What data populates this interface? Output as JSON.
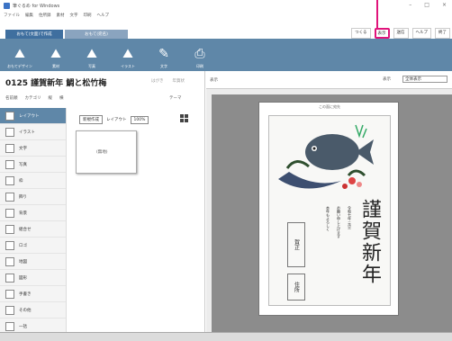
{
  "colors": {
    "accent": "#5f87a8",
    "highlight": "#e0147b",
    "canvas_bg": "#8c8c8c",
    "tab_active": "#3f6f9f",
    "tab_inactive": "#8aa4bf"
  },
  "window": {
    "title": "筆ぐるめ for Windows",
    "controls": [
      "–",
      "□",
      "×"
    ]
  },
  "menubar": [
    "ファイル",
    "編集",
    "住所録",
    "素材",
    "文字",
    "印刷",
    "ヘルプ"
  ],
  "ribbon": {
    "tabs": [
      "おもて(文面)で作成",
      "おもて(宛名)"
    ],
    "right_buttons": [
      {
        "label": "つくる",
        "highlighted": false
      },
      {
        "label": "表示",
        "highlighted": true
      },
      {
        "label": "送信",
        "highlighted": false
      },
      {
        "label": "ヘルプ",
        "highlighted": false
      },
      {
        "label": "終了",
        "highlighted": false
      }
    ]
  },
  "toolbar": [
    {
      "icon": "scenery-icon",
      "label": "おもてデザイン"
    },
    {
      "icon": "scenery-icon",
      "label": "素材"
    },
    {
      "icon": "scenery-icon",
      "label": "写真"
    },
    {
      "icon": "scenery-icon",
      "label": "イラスト"
    },
    {
      "icon": "brush-icon",
      "label": "文字"
    },
    {
      "icon": "printer-icon",
      "label": "印刷"
    }
  ],
  "left": {
    "doc_title": "0125 謹賀新年 鯛と松竹梅",
    "head_right": [
      "はがき",
      "年賀状"
    ],
    "filters": [
      "名前順",
      "カテゴリ",
      "縦",
      "横"
    ],
    "filter_right": "テーマ",
    "categories": [
      {
        "label": "レイアウト",
        "selected": true
      },
      {
        "label": "イラスト",
        "selected": false
      },
      {
        "label": "文字",
        "selected": false
      },
      {
        "label": "写真",
        "selected": false
      },
      {
        "label": "枠",
        "selected": false
      },
      {
        "label": "飾り",
        "selected": false
      },
      {
        "label": "背景",
        "selected": false
      },
      {
        "label": "組合せ",
        "selected": false
      },
      {
        "label": "ロゴ",
        "selected": false
      },
      {
        "label": "地図",
        "selected": false
      },
      {
        "label": "図形",
        "selected": false
      },
      {
        "label": "手書き",
        "selected": false
      },
      {
        "label": "その他",
        "selected": false
      },
      {
        "label": "一括",
        "selected": false
      }
    ],
    "thumb_tools": [
      "新規作成",
      "レイアウト",
      "100%"
    ],
    "thumb_label": "(無地)"
  },
  "right": {
    "head_label": "表示",
    "zoom_label": "表示",
    "zoom_select": "全体表示",
    "postcard_top": "この面に宛先",
    "greeting": "謹賀新年",
    "small_lines": [
      "本年もよろしく",
      "お願い申し上げます",
      "令和七年 元旦"
    ],
    "addr_label": "賀正",
    "sender_label": "住所"
  }
}
